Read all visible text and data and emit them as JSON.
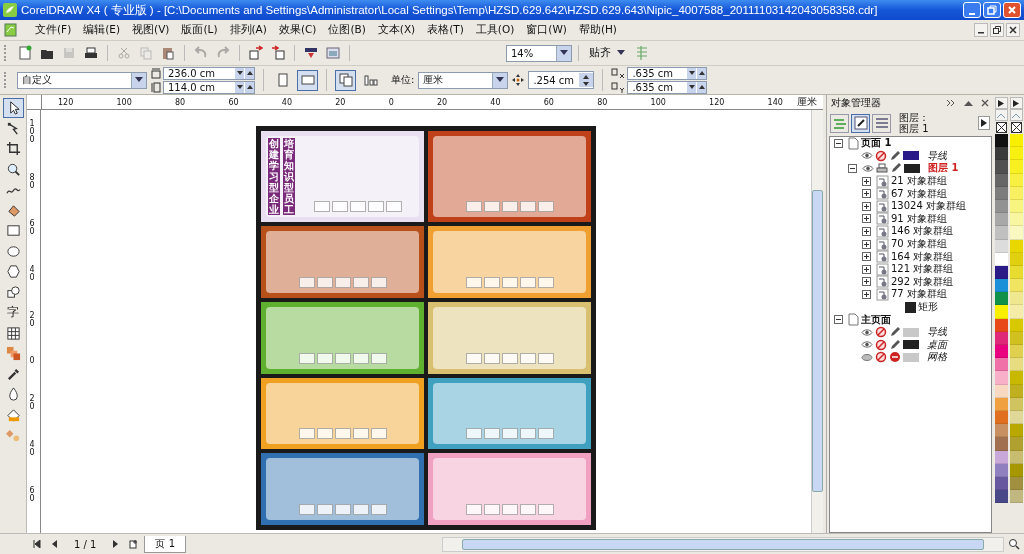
{
  "window": {
    "title": "CorelDRAW X4 ( 专业版 ) - [C:\\Documents and Settings\\Administrator\\Local Settings\\Temp\\HZSD.629.642\\HZSD.629.643\\Nipic_4007588_20111103142043058358.cdr]"
  },
  "menu": [
    "文件(F)",
    "编辑(E)",
    "视图(V)",
    "版面(L)",
    "排列(A)",
    "效果(C)",
    "位图(B)",
    "文本(X)",
    "表格(T)",
    "工具(O)",
    "窗口(W)",
    "帮助(H)"
  ],
  "standard_toolbar": {
    "buttons": [
      {
        "kind": "new",
        "disabled": false
      },
      {
        "kind": "open",
        "disabled": false
      },
      {
        "kind": "save",
        "disabled": true
      },
      {
        "kind": "print",
        "disabled": false
      },
      {
        "kind": "cut",
        "disabled": true
      },
      {
        "kind": "copy",
        "disabled": true
      },
      {
        "kind": "paste",
        "disabled": false
      },
      {
        "kind": "undo",
        "disabled": true
      },
      {
        "kind": "redo",
        "disabled": true
      },
      {
        "kind": "import",
        "disabled": false
      },
      {
        "kind": "export",
        "disabled": false
      },
      {
        "kind": "launcher",
        "disabled": false
      },
      {
        "kind": "welcome",
        "disabled": false
      }
    ],
    "zoom": "14%",
    "snap": "贴齐"
  },
  "property_bar": {
    "page_size": "自定义",
    "width": "236.0 cm",
    "height": "114.0 cm",
    "orientation": [
      {
        "kind": "portrait",
        "selected": false
      },
      {
        "kind": "landscape",
        "selected": true
      }
    ],
    "page_layout": [
      {
        "kind": "all-pages",
        "selected": true
      },
      {
        "kind": "current-page",
        "selected": false
      }
    ],
    "unit_label": "单位:",
    "unit": "厘米",
    "nudge": ".254 cm",
    "duplicate_x": ".635 cm",
    "duplicate_y": ".635 cm"
  },
  "toolbox": [
    {
      "kind": "pick",
      "selected": true
    },
    {
      "kind": "shape",
      "selected": false
    },
    {
      "kind": "crop",
      "selected": false
    },
    {
      "kind": "zoom",
      "selected": false
    },
    {
      "kind": "freehand",
      "selected": false
    },
    {
      "kind": "smart-fill",
      "selected": false
    },
    {
      "kind": "rectangle",
      "selected": false
    },
    {
      "kind": "ellipse",
      "selected": false
    },
    {
      "kind": "polygon",
      "selected": false
    },
    {
      "kind": "basic-shapes",
      "selected": false
    },
    {
      "kind": "text",
      "label": "字",
      "selected": false
    },
    {
      "kind": "table",
      "selected": false
    },
    {
      "kind": "blend",
      "selected": false
    },
    {
      "kind": "eyedropper",
      "selected": false
    },
    {
      "kind": "outline",
      "selected": false
    },
    {
      "kind": "fill",
      "selected": false
    },
    {
      "kind": "interactive-fill",
      "selected": false
    }
  ],
  "rulers": {
    "horizontal": [
      "120",
      "100",
      "80",
      "60",
      "40",
      "20",
      "0",
      "20",
      "40",
      "60",
      "80",
      "100",
      "120",
      "140"
    ],
    "unit": "厘米",
    "vertical": [
      "100",
      "80",
      "60",
      "40",
      "20",
      "0",
      "20",
      "40",
      "60"
    ]
  },
  "canvas": {
    "panels": [
      {
        "color": "#e8e0f0",
        "titles": [
          "创建学习型企业",
          "培育知识型员工"
        ]
      },
      {
        "color": "#c0401a"
      },
      {
        "color": "#b8501a"
      },
      {
        "color": "#f0a030"
      },
      {
        "color": "#60b030"
      },
      {
        "color": "#d8c070"
      },
      {
        "color": "#f0a020"
      },
      {
        "color": "#40a0c0"
      },
      {
        "color": "#3070b0"
      },
      {
        "color": "#f0a0c0"
      }
    ]
  },
  "object_manager": {
    "title": "对象管理器",
    "layer_label": "图层：",
    "layer_value": "图层 1",
    "tree": [
      {
        "kind": "page",
        "label": "页面 1",
        "expanded": true,
        "children": [
          {
            "kind": "layer",
            "label": "导线",
            "color": "#2a1a88",
            "active": false,
            "visible": true,
            "printable": false,
            "editable": true
          },
          {
            "kind": "layer",
            "label": "图层 1",
            "color": "#222222",
            "active": true,
            "visible": true,
            "printable": true,
            "editable": true,
            "expanded": true,
            "children": [
              {
                "kind": "group",
                "label": "21 对象群组",
                "expanded": false
              },
              {
                "kind": "group",
                "label": "67 对象群组",
                "expanded": false
              },
              {
                "kind": "group",
                "label": "13024 对象群组",
                "expanded": false
              },
              {
                "kind": "group",
                "label": "91 对象群组",
                "expanded": false
              },
              {
                "kind": "group",
                "label": "146 对象群组",
                "expanded": false
              },
              {
                "kind": "group",
                "label": "70 对象群组",
                "expanded": false
              },
              {
                "kind": "group",
                "label": "164 对象群组",
                "expanded": false
              },
              {
                "kind": "group",
                "label": "121 对象群组",
                "expanded": false
              },
              {
                "kind": "group",
                "label": "292 对象群组",
                "expanded": false
              },
              {
                "kind": "group",
                "label": "77 对象群组",
                "expanded": false
              },
              {
                "kind": "object",
                "label": "矩形",
                "color": "#222222"
              }
            ]
          }
        ]
      },
      {
        "kind": "page",
        "label": "主页面",
        "expanded": true,
        "children": [
          {
            "kind": "layer",
            "label": "导线",
            "color": "#c8c8c8",
            "active": false,
            "visible": true,
            "printable": false,
            "editable": true
          },
          {
            "kind": "layer",
            "label": "桌面",
            "color": "#222222",
            "active": false,
            "visible": true,
            "printable": false,
            "editable": true
          },
          {
            "kind": "layer",
            "label": "网格",
            "color": "#c8c8c8",
            "active": false,
            "visible": false,
            "printable": false,
            "editable": false
          }
        ]
      }
    ]
  },
  "palette": {
    "columns": [
      [
        {
          "color": "#111111"
        },
        {
          "color": "#3a3a3a"
        },
        {
          "color": "#505050"
        },
        {
          "color": "#666666"
        },
        {
          "color": "#7c7c7c"
        },
        {
          "color": "#929292"
        },
        {
          "color": "#a8a8a8"
        },
        {
          "color": "#c0c0c0"
        },
        {
          "color": "#dcdcdc"
        },
        {
          "color": "#ffffff"
        },
        {
          "color": "#2a1a88"
        },
        {
          "color": "#1a90d8"
        },
        {
          "color": "#109048"
        },
        {
          "color": "#f8f000"
        },
        {
          "color": "#e84818"
        },
        {
          "color": "#e02878"
        },
        {
          "color": "#e8007f"
        },
        {
          "color": "#f070a8"
        },
        {
          "color": "#f8b0c8"
        },
        {
          "color": "#f8d8c0"
        },
        {
          "color": "#f0a040"
        },
        {
          "color": "#e07020"
        },
        {
          "color": "#c89060"
        },
        {
          "color": "#a07050"
        },
        {
          "color": "#c8a8d8"
        },
        {
          "color": "#9080c0"
        },
        {
          "color": "#6858a0"
        },
        {
          "color": "#484888"
        }
      ],
      [
        {
          "color": "#f8f000"
        },
        {
          "color": "#f8f010"
        },
        {
          "color": "#f8f020"
        },
        {
          "color": "#f8f040"
        },
        {
          "color": "#f8f060"
        },
        {
          "color": "#f8f480"
        },
        {
          "color": "#f8f6a0"
        },
        {
          "color": "#f8f8c0"
        },
        {
          "color": "#e8d800"
        },
        {
          "color": "#e0d010"
        },
        {
          "color": "#e8dc30"
        },
        {
          "color": "#f0e460"
        },
        {
          "color": "#f0e890"
        },
        {
          "color": "#f4eca8"
        },
        {
          "color": "#d8c800"
        },
        {
          "color": "#d0c020"
        },
        {
          "color": "#e0d050"
        },
        {
          "color": "#e8dc80"
        },
        {
          "color": "#c8b800"
        },
        {
          "color": "#c0b020"
        },
        {
          "color": "#d0c460"
        },
        {
          "color": "#e0d898"
        },
        {
          "color": "#b8a800"
        },
        {
          "color": "#b0a030"
        },
        {
          "color": "#c8bc70"
        },
        {
          "color": "#a89800"
        },
        {
          "color": "#a09040"
        },
        {
          "color": "#c0b880"
        }
      ]
    ]
  },
  "page_nav": {
    "count": "1 / 1",
    "tab": "页 1"
  }
}
